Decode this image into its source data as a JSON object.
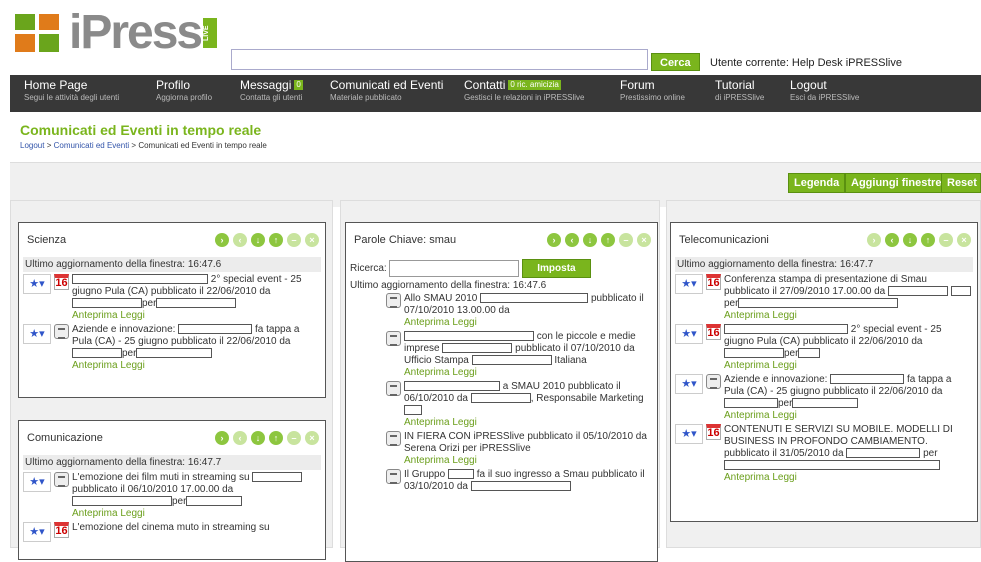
{
  "header": {
    "logo_text": "iPress",
    "logo_live": "LIVE",
    "search_value": "",
    "search_button": "Cerca",
    "current_user": "Utente corrente: Help Desk iPRESSlive"
  },
  "nav": [
    {
      "title": "Home Page",
      "sub": "Segui le attività degli utenti"
    },
    {
      "title": "Profilo",
      "sub": "Aggiorna profilo"
    },
    {
      "title": "Messaggi",
      "badge": "0",
      "sub": "Contatta gli utenti"
    },
    {
      "title": "Comunicati ed Eventi",
      "sub": "Materiale pubblicato"
    },
    {
      "title": "Contatti",
      "badge": "0 ric. amicizia",
      "sub": "Gestisci le relazioni in iPRESSlive"
    },
    {
      "title": "Forum",
      "sub": "Prestissimo online"
    },
    {
      "title": "Tutorial",
      "sub": "di iPRESSlive"
    },
    {
      "title": "Logout",
      "sub": "Esci da iPRESSlive"
    }
  ],
  "page": {
    "title": "Comunicati ed Eventi in tempo reale",
    "breadcrumb": [
      "Logout",
      "Comunicati ed Eventi",
      "Comunicati ed Eventi in tempo reale"
    ]
  },
  "toolbar": {
    "legenda": "Legenda",
    "aggiungi": "Aggiungi finestre",
    "reset": "Reset"
  },
  "panels": {
    "scienza": {
      "title": "Scienza",
      "updated": "Ultimo aggiornamento della finestra: 16:47.6",
      "e1": "2° special event - 25 giugno Pula (CA) pubblicato il 22/06/2010 da",
      "e2": "Aziende e innovazione:",
      "e2b": "fa tappa a Pula (CA) - 25 giugno pubblicato il 22/06/2010 da"
    },
    "comunicazione": {
      "title": "Comunicazione",
      "updated": "Ultimo aggiornamento della finestra: 16:47.7",
      "e1": "L'emozione dei film muti in streaming su",
      "e1b": "pubblicato il 06/10/2010 17.00.00 da",
      "e2": "L'emozione del cinema muto in streaming su"
    },
    "smau": {
      "title": "Parole Chiave: smau",
      "search_label": "Ricerca:",
      "search_button": "Imposta",
      "updated": "Ultimo aggiornamento della finestra: 16:47.6",
      "e1": "Allo SMAU 2010",
      "e1b": "pubblicato il 07/10/2010 13.00.00 da",
      "e2": "con le piccole e medie imprese",
      "e2b": "pubblicato il 07/10/2010 da Ufficio Stampa",
      "e2c": "Italiana",
      "e3": "a SMAU 2010 pubblicato il 06/10/2010 da",
      "e3b": ", Responsabile Marketing",
      "e4": "IN FIERA CON iPRESSlive pubblicato il 05/10/2010 da Serena Orizi per iPRESSlive",
      "e5": "Il Gruppo",
      "e5b": "fa il suo ingresso a Smau pubblicato il 03/10/2010 da"
    },
    "tele": {
      "title": "Telecomunicazioni",
      "updated": "Ultimo aggiornamento della finestra: 16:47.7",
      "e1": "Conferenza stampa di presentazione di Smau pubblicato il 27/09/2010 17.00.00 da",
      "e2": "2° special event - 25 giugno Pula (CA) pubblicato il 22/06/2010 da",
      "e3": "Aziende e innovazione:",
      "e3b": "fa tappa a Pula (CA) - 25 giugno pubblicato il 22/06/2010 da",
      "e4": "CONTENUTI E SERVIZI SU MOBILE. MODELLI DI BUSINESS IN PROFONDO CAMBIAMENTO. pubblicato il 31/05/2010 da"
    }
  },
  "common": {
    "per": "per",
    "anteprima": "Anteprima",
    "leggi": "Leggi",
    "day": "16"
  }
}
